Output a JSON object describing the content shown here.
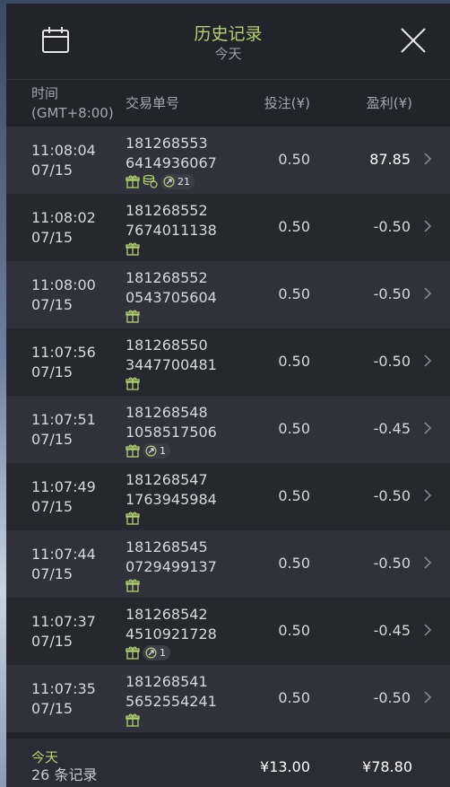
{
  "colors": {
    "accent_green": "#b3d36f",
    "panel_bg": "#23232c"
  },
  "header": {
    "title": "历史记录",
    "subtitle": "今天",
    "left_icon": "calendar-icon",
    "right_icon": "close-icon"
  },
  "columns": {
    "time_line1": "时间",
    "time_line2": "(GMT+8:00)",
    "order": "交易单号",
    "bet": "投注(¥)",
    "win": "盈利(¥)"
  },
  "rows": [
    {
      "time": "11:08:04",
      "date": "07/15",
      "order1": "181268553",
      "order2": "6414936067",
      "bet": "0.50",
      "win": "87.85",
      "icons": [
        "gift-icon",
        "coins-icon"
      ],
      "badge": "21"
    },
    {
      "time": "11:08:02",
      "date": "07/15",
      "order1": "181268552",
      "order2": "7674011138",
      "bet": "0.50",
      "win": "-0.50",
      "icons": [
        "gift-icon"
      ],
      "badge": ""
    },
    {
      "time": "11:08:00",
      "date": "07/15",
      "order1": "181268552",
      "order2": "0543705604",
      "bet": "0.50",
      "win": "-0.50",
      "icons": [
        "gift-icon"
      ],
      "badge": ""
    },
    {
      "time": "11:07:56",
      "date": "07/15",
      "order1": "181268550",
      "order2": "3447700481",
      "bet": "0.50",
      "win": "-0.50",
      "icons": [
        "gift-icon"
      ],
      "badge": ""
    },
    {
      "time": "11:07:51",
      "date": "07/15",
      "order1": "181268548",
      "order2": "1058517506",
      "bet": "0.50",
      "win": "-0.45",
      "icons": [
        "gift-icon"
      ],
      "badge": "1"
    },
    {
      "time": "11:07:49",
      "date": "07/15",
      "order1": "181268547",
      "order2": "1763945984",
      "bet": "0.50",
      "win": "-0.50",
      "icons": [
        "gift-icon"
      ],
      "badge": ""
    },
    {
      "time": "11:07:44",
      "date": "07/15",
      "order1": "181268545",
      "order2": "0729499137",
      "bet": "0.50",
      "win": "-0.50",
      "icons": [
        "gift-icon"
      ],
      "badge": ""
    },
    {
      "time": "11:07:37",
      "date": "07/15",
      "order1": "181268542",
      "order2": "4510921728",
      "bet": "0.50",
      "win": "-0.45",
      "icons": [
        "gift-icon"
      ],
      "badge": "1"
    },
    {
      "time": "11:07:35",
      "date": "07/15",
      "order1": "181268541",
      "order2": "5652554241",
      "bet": "0.50",
      "win": "-0.50",
      "icons": [
        "gift-icon"
      ],
      "badge": ""
    }
  ],
  "footer": {
    "label": "今天",
    "count": "26 条记录",
    "total_bet": "¥13.00",
    "total_win": "¥78.80"
  }
}
